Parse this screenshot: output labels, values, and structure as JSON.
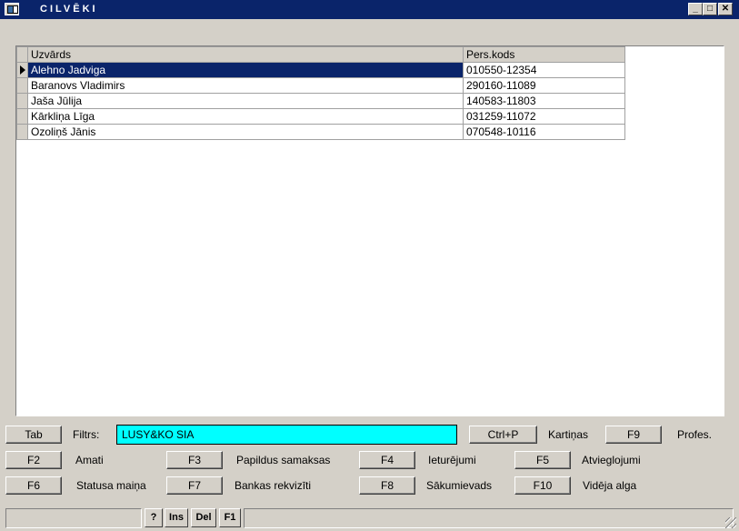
{
  "window": {
    "title": "CILVĒKI"
  },
  "grid": {
    "columns": [
      "Uzvārds",
      "Pers.kods"
    ],
    "rows": [
      {
        "name": "Alehno Jadviga",
        "code": "010550-12354",
        "selected": true
      },
      {
        "name": "Baranovs Vladimirs",
        "code": "290160-11089"
      },
      {
        "name": "Jaša Jūlija",
        "code": "140583-11803"
      },
      {
        "name": "Kārkliņa Līga",
        "code": "031259-11072"
      },
      {
        "name": "Ozoliņš Jānis",
        "code": "070548-10116"
      }
    ]
  },
  "filter": {
    "tab_key": "Tab",
    "label": "Filtrs:",
    "value": "LUSY&KO SIA"
  },
  "keys": {
    "ctrlp": "Ctrl+P",
    "ctrlp_label": "Kartiņas",
    "f9": "F9",
    "f9_label": "Profes.",
    "f2": "F2",
    "f2_label": "Amati",
    "f3": "F3",
    "f3_label": "Papildus samaksas",
    "f4": "F4",
    "f4_label": "Ieturējumi",
    "f5": "F5",
    "f5_label": "Atvieglojumi",
    "f6": "F6",
    "f6_label": "Statusa maiņa",
    "f7": "F7",
    "f7_label": "Bankas rekvizīti",
    "f8": "F8",
    "f8_label": "Sākumievads",
    "f10": "F10",
    "f10_label": "Vidēja alga"
  },
  "status": {
    "help": "?",
    "ins": "Ins",
    "del": "Del",
    "f1": "F1"
  },
  "colors": {
    "titlebar": "#0a246a",
    "filter_bg": "#00ffff",
    "window_bg": "#d4d0c8"
  }
}
